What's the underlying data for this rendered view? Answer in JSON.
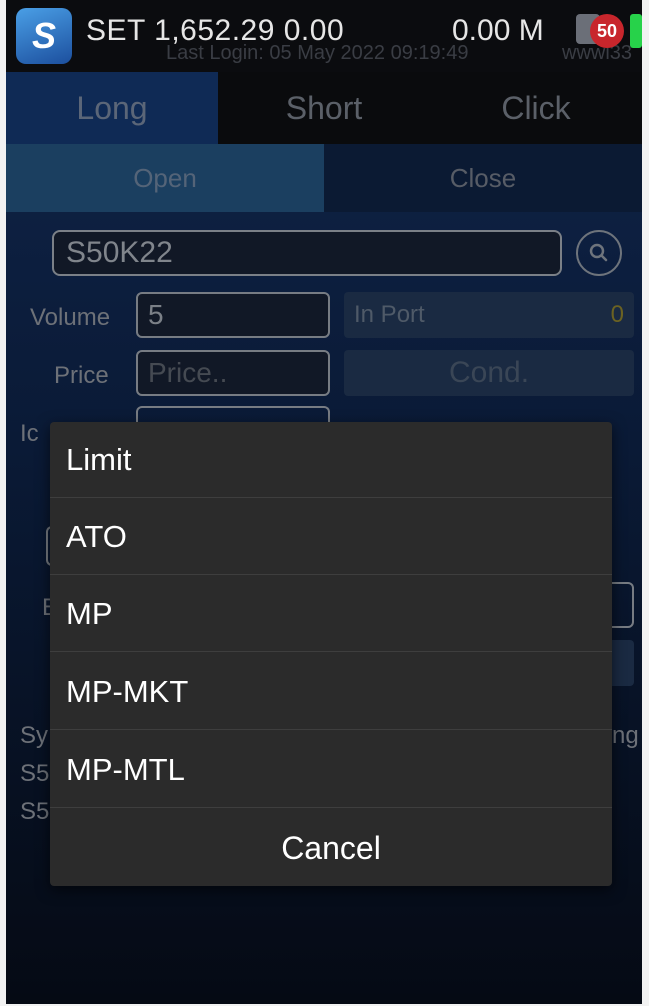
{
  "status_bar": {
    "index_text": "SET 1,652.29  0.00",
    "volume_text": "0.00 M",
    "last_login": "Last Login: 05 May 2022 09:19:49",
    "user_id": "wwwi33",
    "notification_count": "50",
    "app_logo_glyph": "S"
  },
  "tabs": {
    "long": "Long",
    "short": "Short",
    "click": "Click"
  },
  "subtabs": {
    "open": "Open",
    "close": "Close"
  },
  "form": {
    "symbol_value": "S50K22",
    "volume_label": "Volume",
    "volume_value": "5",
    "in_port_label": "In Port",
    "in_port_value": "0",
    "price_label": "Price",
    "price_placeholder": "Price..",
    "cond_label": "Cond.",
    "partial_left_1": "Ic",
    "partial_left_2": "E",
    "partial_left_3": "Sy",
    "partial_left_4": "S5",
    "partial_left_5": "S5",
    "partial_right_1": "ng"
  },
  "dialog": {
    "options": [
      "Limit",
      "ATO",
      "MP",
      "MP-MKT",
      "MP-MTL"
    ],
    "cancel_label": "Cancel"
  },
  "colors": {
    "accent": "#0f2a55",
    "badge": "#c8262c",
    "battery": "#27d24a"
  }
}
